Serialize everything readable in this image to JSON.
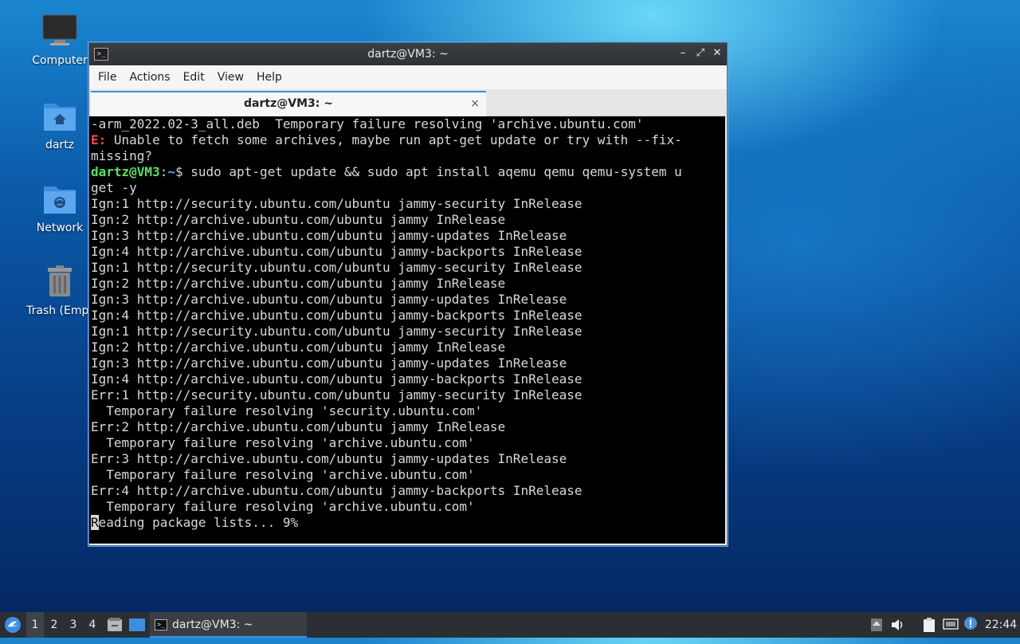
{
  "desktop": {
    "icons": [
      {
        "label": "Computer",
        "icon": "monitor-icon"
      },
      {
        "label": "dartz",
        "icon": "home-folder-icon"
      },
      {
        "label": "Network",
        "icon": "network-folder-icon"
      },
      {
        "label": "Trash (Empt",
        "icon": "trash-icon"
      }
    ]
  },
  "window": {
    "title": "dartz@VM3: ~",
    "menu": [
      "File",
      "Actions",
      "Edit",
      "View",
      "Help"
    ],
    "tab_label": "dartz@VM3: ~",
    "tab_close": "×",
    "controls": {
      "minimize": "–",
      "maximize": "⤢",
      "close": "✕"
    }
  },
  "terminal": {
    "lines": [
      "-arm_2022.02-3_all.deb  Temporary failure resolving 'archive.ubuntu.com'",
      "E:",
      " Unable to fetch some archives, maybe run apt-get update or try with --fix-",
      "missing?",
      "dartz@VM3",
      ":",
      "~",
      "$ sudo apt-get update && sudo apt install aqemu qemu qemu-system u",
      "get -y",
      "Ign:1 http://security.ubuntu.com/ubuntu jammy-security InRelease",
      "Ign:2 http://archive.ubuntu.com/ubuntu jammy InRelease",
      "Ign:3 http://archive.ubuntu.com/ubuntu jammy-updates InRelease",
      "Ign:4 http://archive.ubuntu.com/ubuntu jammy-backports InRelease",
      "Ign:1 http://security.ubuntu.com/ubuntu jammy-security InRelease",
      "Ign:2 http://archive.ubuntu.com/ubuntu jammy InRelease",
      "Ign:3 http://archive.ubuntu.com/ubuntu jammy-updates InRelease",
      "Ign:4 http://archive.ubuntu.com/ubuntu jammy-backports InRelease",
      "Ign:1 http://security.ubuntu.com/ubuntu jammy-security InRelease",
      "Ign:2 http://archive.ubuntu.com/ubuntu jammy InRelease",
      "Ign:3 http://archive.ubuntu.com/ubuntu jammy-updates InRelease",
      "Ign:4 http://archive.ubuntu.com/ubuntu jammy-backports InRelease",
      "Err:1 http://security.ubuntu.com/ubuntu jammy-security InRelease",
      "  Temporary failure resolving 'security.ubuntu.com'",
      "Err:2 http://archive.ubuntu.com/ubuntu jammy InRelease",
      "  Temporary failure resolving 'archive.ubuntu.com'",
      "Err:3 http://archive.ubuntu.com/ubuntu jammy-updates InRelease",
      "  Temporary failure resolving 'archive.ubuntu.com'",
      "Err:4 http://archive.ubuntu.com/ubuntu jammy-backports InRelease",
      "  Temporary failure resolving 'archive.ubuntu.com'",
      "R",
      "eading package lists... 9%"
    ]
  },
  "taskbar": {
    "workspaces": [
      "1",
      "2",
      "3",
      "4"
    ],
    "active_workspace": "1",
    "task_label": "dartz@VM3: ~",
    "clock": "22:44"
  }
}
